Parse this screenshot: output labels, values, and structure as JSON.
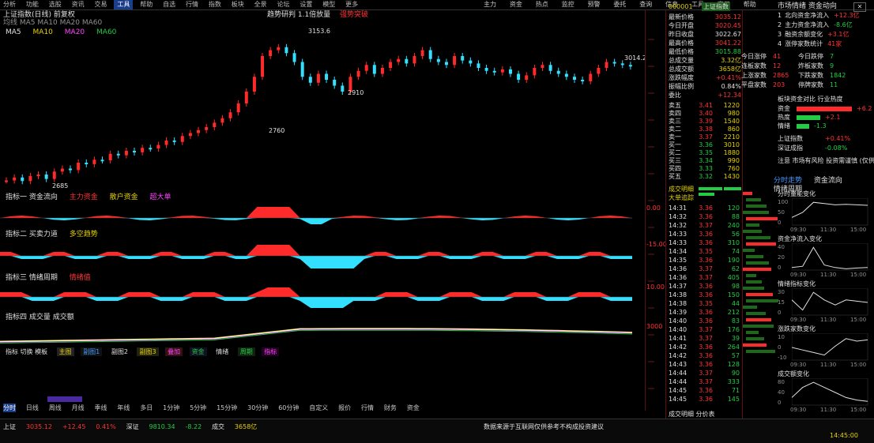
{
  "menu": {
    "items": [
      "分析",
      "功能",
      "选股",
      "资讯",
      "交易",
      "工具",
      "帮助",
      "自选",
      "行情",
      "指数",
      "板块",
      "全景",
      "论坛",
      "设置",
      "模型",
      "更多"
    ],
    "active_index": 5,
    "right_items": [
      "主力",
      "资金",
      "热点",
      "监控",
      "预警",
      "委托",
      "查询",
      "信息",
      "工具",
      "窗口",
      "帮助"
    ]
  },
  "chart": {
    "header_left": "上证指数(日线) 前复权",
    "header_sub": "均线 MA5 MA10 MA20 MA60",
    "header_center": "趋势研判 1.1倍放量",
    "header_center_tag": "强势突破",
    "ma_labels": [
      "MA5",
      "MA10",
      "MA20",
      "MA60"
    ],
    "high_label": "3153.6",
    "low_label": "2685",
    "mid_label": "2910",
    "left_label": "2760",
    "right_label": "3014.2"
  },
  "candles": [
    2700,
    2710,
    2698,
    2715,
    2720,
    2705,
    2730,
    2740,
    2735,
    2760,
    2755,
    2770,
    2768,
    2790,
    2785,
    2800,
    2795,
    2810,
    2808,
    2820,
    2835,
    2830,
    2850,
    2860,
    2870,
    2880,
    2895,
    2910,
    2930,
    2960,
    3000,
    3050,
    3120,
    3140,
    3150,
    3130,
    3100,
    3050,
    3030,
    3060,
    3040,
    3020,
    3000,
    3050,
    3070,
    3090,
    3060,
    3080,
    3100,
    3110,
    3095,
    3120,
    3140,
    3110,
    3100,
    3090,
    3120,
    3105,
    3095,
    3080,
    3070,
    3065,
    3075,
    3060,
    3040,
    3055,
    3080,
    3090,
    3070,
    3060,
    3050,
    3040,
    3035,
    3060,
    3080,
    3100,
    3095,
    3090,
    3085
  ],
  "indicators": [
    {
      "title": "指标一 资金流向",
      "tags": [
        "主力资金",
        "散户资金",
        "超大单"
      ],
      "label": "0.00"
    },
    {
      "title": "指标二 买卖力道",
      "tags": [
        "多空趋势"
      ],
      "label": "-15.00"
    },
    {
      "title": "指标三 情绪周期",
      "tags": [
        "情绪值"
      ],
      "label": "10.00"
    },
    {
      "title": "指标四 成交量 成交额",
      "tags": [],
      "label": "3000"
    }
  ],
  "bottom_indicator_bar": {
    "title": "指标 切换 模板",
    "items": [
      "主图",
      "副图1",
      "副图2",
      "副图3",
      "叠加",
      "资金",
      "情绪",
      "周期",
      "指标"
    ]
  },
  "bottom_tabs": [
    "分时",
    "日线",
    "周线",
    "月线",
    "季线",
    "年线",
    "多日",
    "1分钟",
    "5分钟",
    "15分钟",
    "30分钟",
    "60分钟",
    "自定义",
    "报价",
    "行情",
    "财务",
    "资金"
  ],
  "status_row": [
    "上证",
    "3035.12",
    "+12.45",
    "0.41%",
    "深证",
    "9810.34",
    "-8.22",
    "成交",
    "3658亿"
  ],
  "status_right": "数据来源于互联网仅供参考不构成投资建议",
  "status_time": "14:45:00",
  "quote": {
    "title": "上证指数",
    "code": "000001",
    "stats_labels": [
      "最新价格",
      "今日开盘",
      "昨日收盘",
      "最高价格",
      "最低价格",
      "总成交量",
      "总成交额",
      "涨跌幅度",
      "振幅比例",
      "委比",
      "内盘",
      "外盘"
    ],
    "stats_values": [
      "3035.12",
      "3020.45",
      "3022.67",
      "3041.22",
      "3015.88",
      "3.32亿",
      "3658亿",
      "+0.41%",
      "0.84%",
      "+12.34",
      "1.72亿",
      "1.60亿"
    ],
    "levels": [
      {
        "label": "卖五",
        "price": "3.41",
        "vol": "1220"
      },
      {
        "label": "卖四",
        "price": "3.40",
        "vol": "980"
      },
      {
        "label": "卖三",
        "price": "3.39",
        "vol": "1540"
      },
      {
        "label": "卖二",
        "price": "3.38",
        "vol": "860"
      },
      {
        "label": "卖一",
        "price": "3.37",
        "vol": "2210"
      },
      {
        "label": "买一",
        "price": "3.36",
        "vol": "3010"
      },
      {
        "label": "买二",
        "price": "3.35",
        "vol": "1880"
      },
      {
        "label": "买三",
        "price": "3.34",
        "vol": "990"
      },
      {
        "label": "买四",
        "price": "3.33",
        "vol": "760"
      },
      {
        "label": "买五",
        "price": "3.32",
        "vol": "1430"
      }
    ],
    "bottom_labels": [
      "成交明细",
      "大单追踪"
    ],
    "ticks": [
      {
        "time": "14:31",
        "price": "3.36",
        "vol": "120"
      },
      {
        "time": "14:32",
        "price": "3.36",
        "vol": "88"
      },
      {
        "time": "14:32",
        "price": "3.37",
        "vol": "240"
      },
      {
        "time": "14:33",
        "price": "3.36",
        "vol": "56"
      },
      {
        "time": "14:33",
        "price": "3.36",
        "vol": "310"
      },
      {
        "time": "14:34",
        "price": "3.35",
        "vol": "74"
      },
      {
        "time": "14:35",
        "price": "3.36",
        "vol": "190"
      },
      {
        "time": "14:36",
        "price": "3.37",
        "vol": "62"
      },
      {
        "time": "14:36",
        "price": "3.37",
        "vol": "405"
      },
      {
        "time": "14:37",
        "price": "3.36",
        "vol": "98"
      },
      {
        "time": "14:38",
        "price": "3.36",
        "vol": "150"
      },
      {
        "time": "14:38",
        "price": "3.35",
        "vol": "44"
      },
      {
        "time": "14:39",
        "price": "3.36",
        "vol": "212"
      },
      {
        "time": "14:40",
        "price": "3.36",
        "vol": "83"
      },
      {
        "time": "14:40",
        "price": "3.37",
        "vol": "176"
      },
      {
        "time": "14:41",
        "price": "3.37",
        "vol": "39"
      },
      {
        "time": "14:42",
        "price": "3.36",
        "vol": "264"
      },
      {
        "time": "14:42",
        "price": "3.36",
        "vol": "57"
      },
      {
        "time": "14:43",
        "price": "3.36",
        "vol": "128"
      },
      {
        "time": "14:44",
        "price": "3.37",
        "vol": "90"
      },
      {
        "time": "14:44",
        "price": "3.37",
        "vol": "333"
      },
      {
        "time": "14:45",
        "price": "3.36",
        "vol": "71"
      },
      {
        "time": "14:45",
        "price": "3.36",
        "vol": "145"
      }
    ],
    "footer": "成交明细 分价表"
  },
  "right_panel": {
    "title": "市场情绪 资金动向",
    "rows": [
      {
        "idx": "1",
        "text": "北向资金净流入",
        "val": "+12.3亿"
      },
      {
        "idx": "2",
        "text": "主力资金净流入",
        "val": "-8.6亿"
      },
      {
        "idx": "3",
        "text": "融资余额变化",
        "val": "+3.1亿"
      },
      {
        "idx": "4",
        "text": "涨停家数统计",
        "val": "41家"
      }
    ],
    "grid": [
      [
        "今日涨停",
        "41",
        "今日跌停",
        "7"
      ],
      [
        "连板家数",
        "12",
        "炸板家数",
        "9"
      ],
      [
        "上涨家数",
        "2865",
        "下跌家数",
        "1842"
      ],
      [
        "平盘家数",
        "203",
        "停牌家数",
        "11"
      ]
    ],
    "compare_title": "板块资金对比 行业热度",
    "compare_rows": [
      {
        "label": "资金",
        "val": "+6.2"
      },
      {
        "label": "热度",
        "val": "+2.1"
      },
      {
        "label": "情绪",
        "val": "-1.3"
      }
    ],
    "trend_rows": [
      {
        "label": "上证指数",
        "val": "+0.41%"
      },
      {
        "label": "深证成指",
        "val": "-0.08%"
      }
    ],
    "notice": "注意 市场有风险 投资需谨慎 (仅供参考)",
    "tabs": [
      "分时走势",
      "资金流向",
      "情绪周期"
    ],
    "minis": [
      {
        "title": "分时量能变化",
        "yticks": [
          "100",
          "50",
          "0"
        ],
        "xticks": [
          "09:30",
          "11:30",
          "15:00"
        ]
      },
      {
        "title": "资金净流入变化",
        "yticks": [
          "40",
          "20",
          "0"
        ],
        "xticks": [
          "09:30",
          "11:30",
          "15:00"
        ]
      },
      {
        "title": "情绪指标变化",
        "yticks": [
          "30",
          "15",
          "0"
        ],
        "xticks": [
          "09:30",
          "11:30",
          "15:00"
        ]
      },
      {
        "title": "涨跌家数变化",
        "yticks": [
          "10",
          "0",
          "-10"
        ],
        "xticks": [
          "09:30",
          "11:30",
          "15:00"
        ]
      },
      {
        "title": "成交额变化",
        "yticks": [
          "80",
          "40",
          "0"
        ],
        "xticks": [
          "09:30",
          "11:30",
          "15:00"
        ]
      }
    ]
  },
  "colors": {
    "up": "#ff2a2a",
    "down": "#33e0ff",
    "panel_bg": "#000000",
    "accent_blue": "#1a3e8c"
  }
}
